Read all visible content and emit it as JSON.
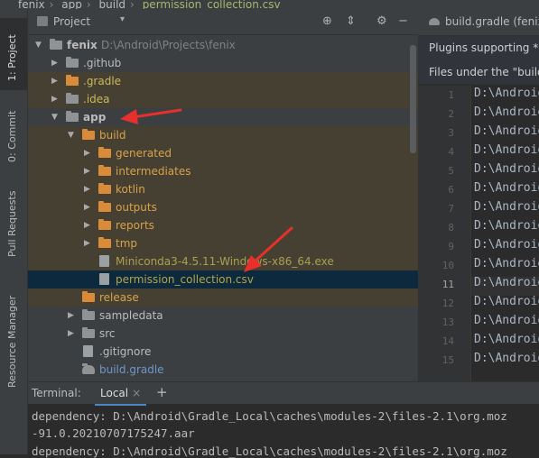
{
  "breadcrumb": {
    "items": [
      "fenix",
      "app",
      "build",
      "permission_collection.csv"
    ]
  },
  "left_strip": {
    "tabs": [
      "1: Project",
      "0: Commit",
      "Pull Requests",
      "Resource Manager"
    ]
  },
  "project_panel": {
    "title": "Project",
    "tree": [
      {
        "label": "fenix",
        "path": "D:\\Android\\Projects\\fenix",
        "indent": 0,
        "arrow": "open",
        "icon": "folder-gray",
        "color": "def",
        "bold": true
      },
      {
        "label": ".github",
        "indent": 1,
        "arrow": "closed",
        "icon": "folder-gray",
        "color": "def"
      },
      {
        "label": ".gradle",
        "indent": 1,
        "arrow": "closed",
        "icon": "folder-orange",
        "color": "yellow",
        "highlight": true
      },
      {
        "label": ".idea",
        "indent": 1,
        "arrow": "closed",
        "icon": "folder-gray",
        "color": "yellow",
        "highlight": true
      },
      {
        "label": "app",
        "indent": 1,
        "arrow": "open",
        "icon": "folder-gray",
        "color": "def",
        "bold": true
      },
      {
        "label": "build",
        "indent": 2,
        "arrow": "open",
        "icon": "folder-orange",
        "color": "orange",
        "highlight": true
      },
      {
        "label": "generated",
        "indent": 3,
        "arrow": "closed",
        "icon": "folder-orange",
        "color": "orange",
        "highlight": true
      },
      {
        "label": "intermediates",
        "indent": 3,
        "arrow": "closed",
        "icon": "folder-orange",
        "color": "orange",
        "highlight": true
      },
      {
        "label": "kotlin",
        "indent": 3,
        "arrow": "closed",
        "icon": "folder-orange",
        "color": "orange",
        "highlight": true
      },
      {
        "label": "outputs",
        "indent": 3,
        "arrow": "closed",
        "icon": "folder-orange",
        "color": "orange",
        "highlight": true
      },
      {
        "label": "reports",
        "indent": 3,
        "arrow": "closed",
        "icon": "folder-orange",
        "color": "orange",
        "highlight": true
      },
      {
        "label": "tmp",
        "indent": 3,
        "arrow": "closed",
        "icon": "folder-orange",
        "color": "orange",
        "highlight": true
      },
      {
        "label": "Miniconda3-4.5.11-Windows-x86_64.exe",
        "indent": 3,
        "arrow": "none",
        "icon": "file",
        "color": "olive",
        "highlight": true
      },
      {
        "label": "permission_collection.csv",
        "indent": 3,
        "arrow": "none",
        "icon": "file",
        "color": "olive2",
        "selected": true
      },
      {
        "label": "release",
        "indent": 2,
        "arrow": "none",
        "icon": "folder-orange",
        "color": "orange",
        "highlight": true
      },
      {
        "label": "sampledata",
        "indent": 2,
        "arrow": "closed",
        "icon": "folder-gray",
        "color": "def"
      },
      {
        "label": "src",
        "indent": 2,
        "arrow": "closed",
        "icon": "folder-gray",
        "color": "def"
      },
      {
        "label": ".gitignore",
        "indent": 2,
        "arrow": "none",
        "icon": "file",
        "color": "def"
      },
      {
        "label": "build.gradle",
        "indent": 2,
        "arrow": "none",
        "icon": "gradle",
        "color": "blue"
      }
    ]
  },
  "editor": {
    "tab": "build.gradle (fenix",
    "banner1": "Plugins supporting *.c",
    "banner2": "Files under the \"build",
    "line_numbers": [
      "1",
      "2",
      "3",
      "4",
      "5",
      "6",
      "7",
      "8",
      "9",
      "10",
      "11",
      "12",
      "13",
      "14",
      "15"
    ],
    "current_line": "11",
    "code_line": "D:\\Android"
  },
  "terminal": {
    "label": "Terminal:",
    "tab": "Local",
    "lines": [
      "dependency: D:\\Android\\Gradle_Local\\caches\\modules-2\\files-2.1\\org.moz",
      "-91.0.20210707175247.aar",
      "dependency: D:\\Android\\Gradle_Local\\caches\\modules-2\\files-2.1\\org.moz"
    ]
  },
  "colors": {
    "annotation_arrow": "#e8302a",
    "selection": "#0d293e",
    "ignored_highlight": "#464032"
  },
  "icons": [
    "target-icon",
    "collapse-icon",
    "gear-icon",
    "minimize-icon",
    "gradle-icon",
    "folder-icon",
    "file-icon"
  ]
}
